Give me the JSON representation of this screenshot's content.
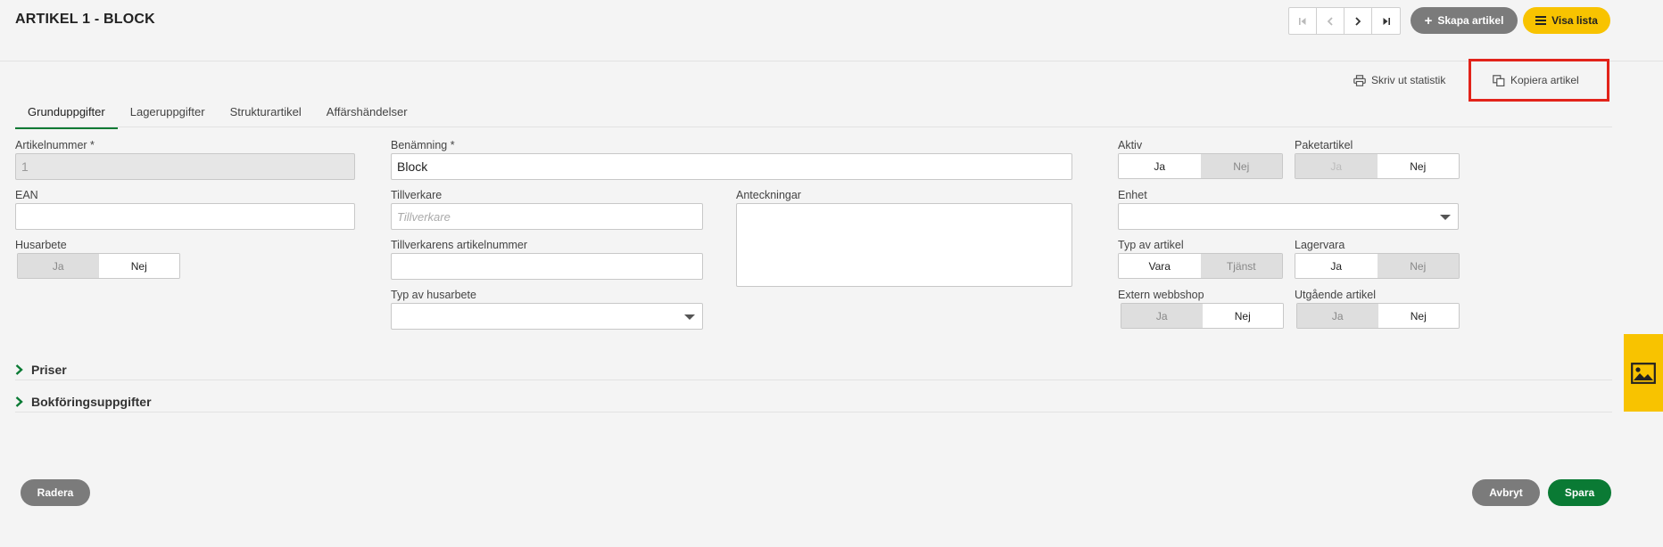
{
  "header": {
    "title": "ARTIKEL 1 - BLOCK",
    "create_label": "Skapa artikel",
    "list_label": "Visa lista"
  },
  "actions": {
    "print_label": "Skriv ut statistik",
    "copy_label": "Kopiera artikel"
  },
  "tabs": [
    "Grunduppgifter",
    "Lageruppgifter",
    "Strukturartikel",
    "Affärshändelser"
  ],
  "form": {
    "article_number": {
      "label": "Artikelnummer *",
      "value": "1"
    },
    "ean": {
      "label": "EAN",
      "value": ""
    },
    "husarbete": {
      "label": "Husarbete",
      "yes": "Ja",
      "no": "Nej"
    },
    "benamning": {
      "label": "Benämning *",
      "value": "Block"
    },
    "tillverkare": {
      "label": "Tillverkare",
      "placeholder": "Tillverkare"
    },
    "tillverkare_nr": {
      "label": "Tillverkarens artikelnummer",
      "value": ""
    },
    "typ_husarbete": {
      "label": "Typ av husarbete",
      "value": ""
    },
    "anteckningar": {
      "label": "Anteckningar",
      "value": ""
    },
    "aktiv": {
      "label": "Aktiv",
      "yes": "Ja",
      "no": "Nej"
    },
    "paketartikel": {
      "label": "Paketartikel",
      "yes": "Ja",
      "no": "Nej"
    },
    "enhet": {
      "label": "Enhet",
      "value": ""
    },
    "typ_artikel": {
      "label": "Typ av artikel",
      "opt1": "Vara",
      "opt2": "Tjänst"
    },
    "lagervara": {
      "label": "Lagervara",
      "yes": "Ja",
      "no": "Nej"
    },
    "extern_webbshop": {
      "label": "Extern webbshop",
      "yes": "Ja",
      "no": "Nej"
    },
    "utgaende": {
      "label": "Utgående artikel",
      "yes": "Ja",
      "no": "Nej"
    }
  },
  "sections": [
    "Priser",
    "Bokföringsuppgifter"
  ],
  "footer": {
    "delete_label": "Radera",
    "cancel_label": "Avbryt",
    "save_label": "Spara"
  },
  "colors": {
    "accent_green": "#0a7a34",
    "accent_yellow": "#f8c300",
    "highlight_red": "#e2231a"
  }
}
